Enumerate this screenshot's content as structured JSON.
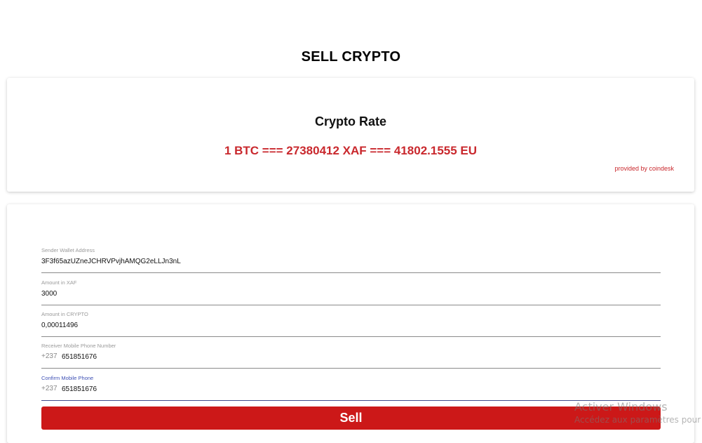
{
  "page": {
    "title": "SELL CRYPTO"
  },
  "rate": {
    "title": "Crypto Rate",
    "value": "1 BTC === 27380412 XAF === 41802.1555 EU",
    "provider": "provided by coindesk",
    "accent_color": "#c9282d"
  },
  "form": {
    "fields": [
      {
        "label": "Sender Wallet Address",
        "value": "3F3f65azUZneJCHRVPvjhAMQG2eLLJn3nL"
      },
      {
        "label": "Amount in XAF",
        "value": "3000"
      },
      {
        "label": "Amount in CRYPTO",
        "value": "0,00011496"
      },
      {
        "label": "Receiver Mobile Phone Number",
        "prefix": "+237",
        "value": "651851676"
      },
      {
        "label": "Confirm Mobile Phone",
        "prefix": "+237",
        "value": "651851676"
      }
    ],
    "submit_label": "Sell",
    "submit_color": "#cc1818"
  },
  "watermark": {
    "title": "Activer Windows",
    "subtitle": "Accédez aux paramètres pour activer Windows."
  }
}
